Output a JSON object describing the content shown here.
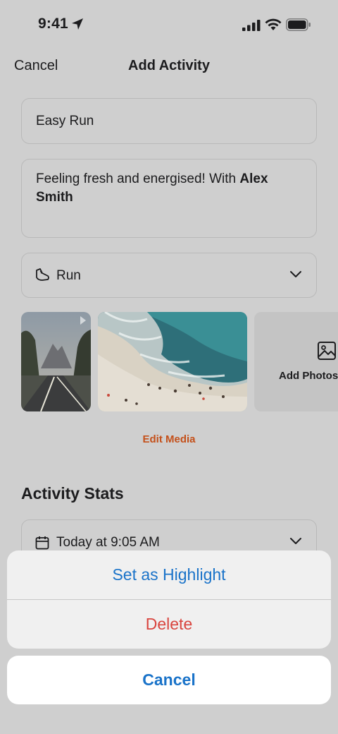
{
  "status_bar": {
    "time": "9:41"
  },
  "nav": {
    "cancel_label": "Cancel",
    "title": "Add Activity"
  },
  "form": {
    "title_value": "Easy Run",
    "description_text": "Feeling fresh and energised! With ",
    "description_mention": "Alex Smith",
    "sport_value": "Run",
    "sport_icon": "running-shoe-icon"
  },
  "media": {
    "add_photos_label": "Add Photos",
    "edit_media_label": "Edit Media"
  },
  "stats": {
    "section_title": "Activity Stats",
    "date_value": "Today at 9:05 AM"
  },
  "action_sheet": {
    "highlight_label": "Set as Highlight",
    "delete_label": "Delete",
    "cancel_label": "Cancel"
  },
  "colors": {
    "accent": "#1a73c9",
    "destructive": "#d9453f",
    "brand": "#c4501a"
  }
}
